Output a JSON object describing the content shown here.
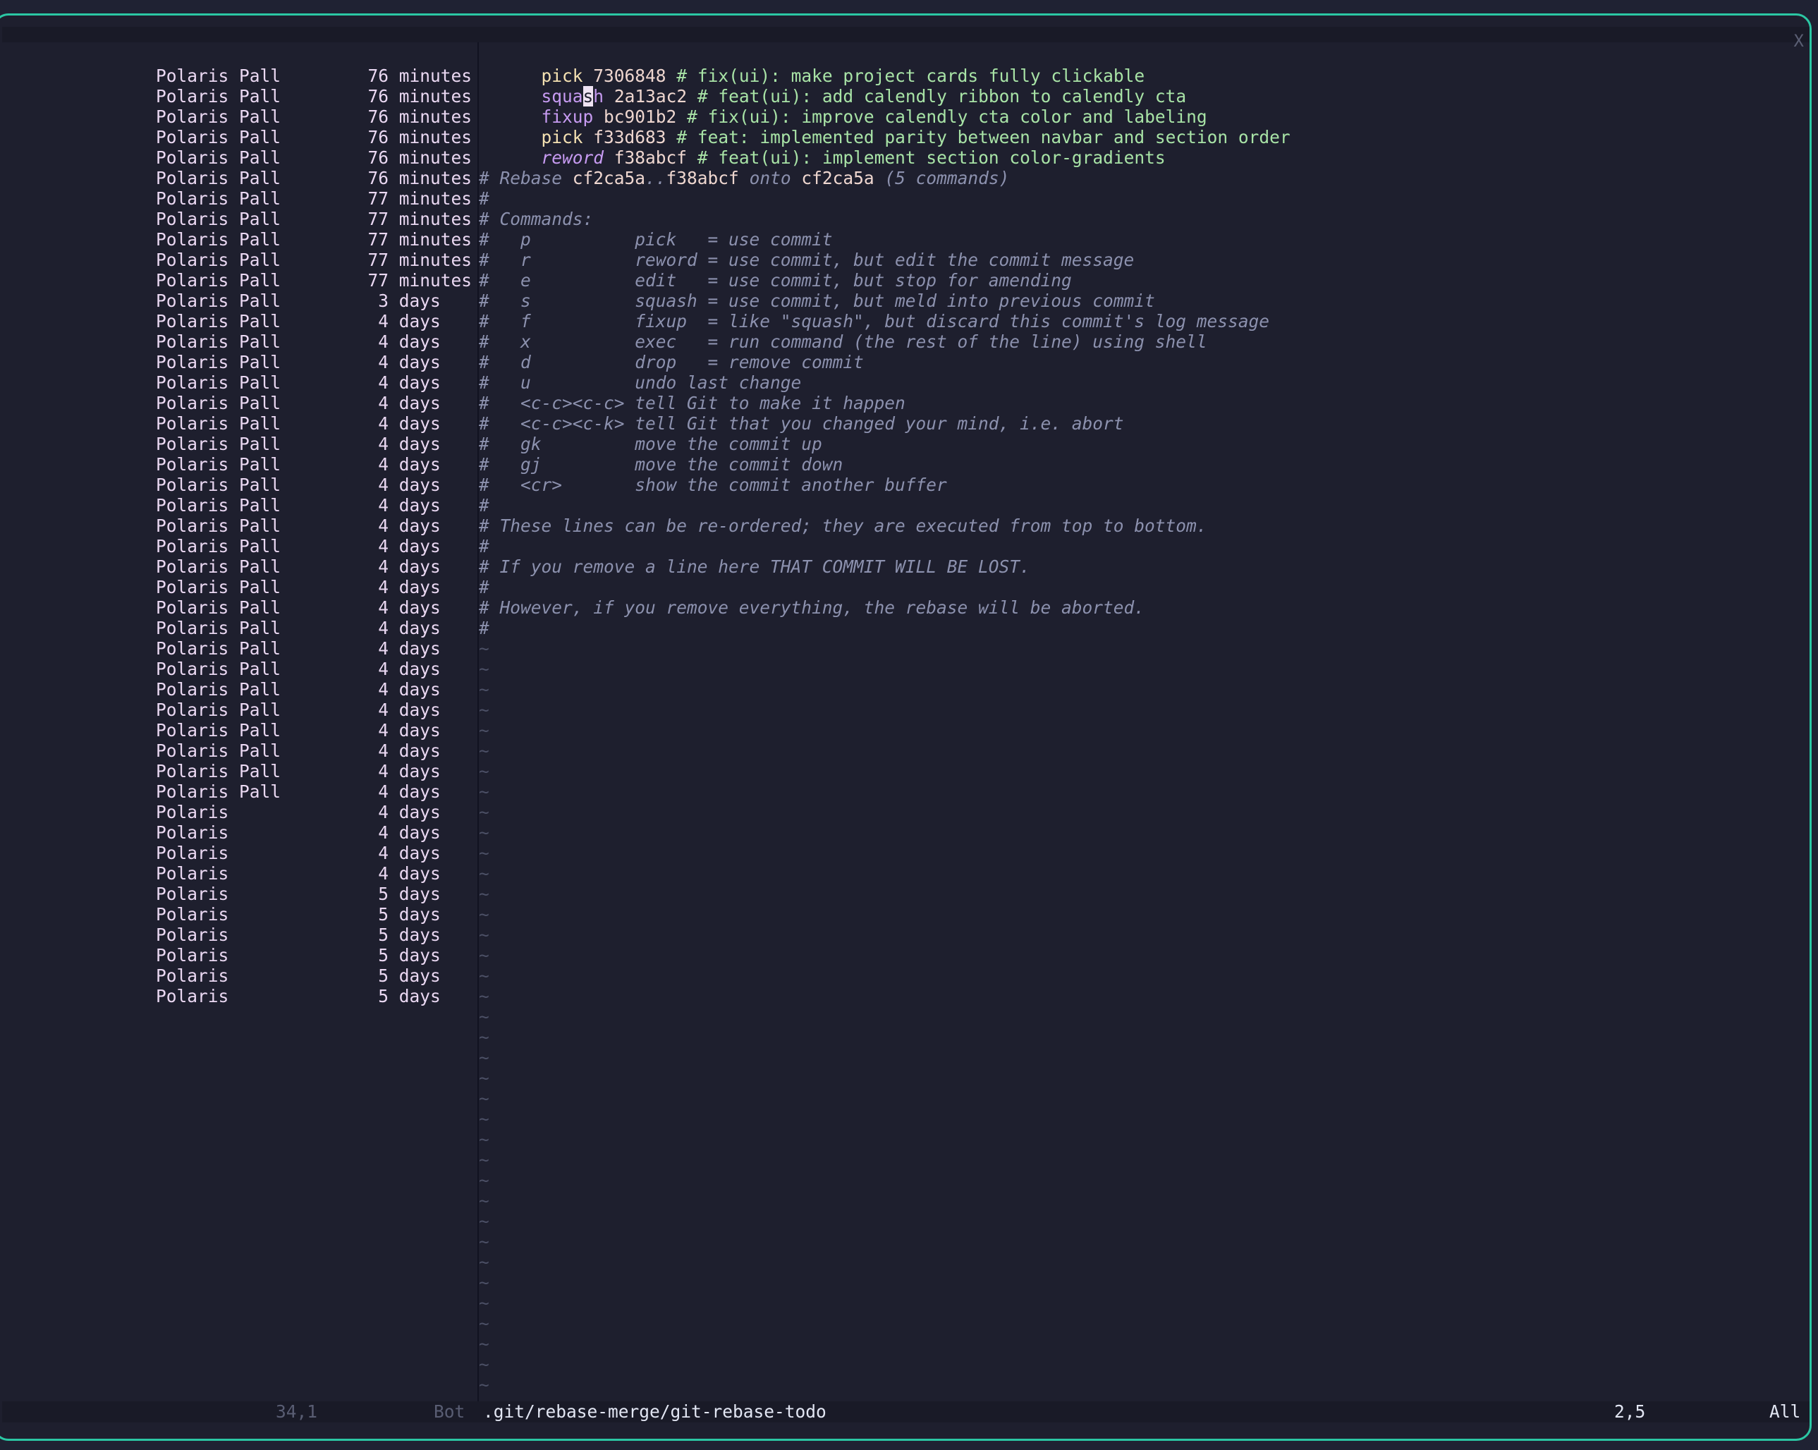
{
  "close_label": "X",
  "blame": [
    {
      "author": "Polaris Pall",
      "age": "76 minutes"
    },
    {
      "author": "Polaris Pall",
      "age": "76 minutes"
    },
    {
      "author": "Polaris Pall",
      "age": "76 minutes"
    },
    {
      "author": "Polaris Pall",
      "age": "76 minutes"
    },
    {
      "author": "Polaris Pall",
      "age": "76 minutes"
    },
    {
      "author": "Polaris Pall",
      "age": "76 minutes"
    },
    {
      "author": "Polaris Pall",
      "age": "77 minutes"
    },
    {
      "author": "Polaris Pall",
      "age": "77 minutes"
    },
    {
      "author": "Polaris Pall",
      "age": "77 minutes"
    },
    {
      "author": "Polaris Pall",
      "age": "77 minutes"
    },
    {
      "author": "Polaris Pall",
      "age": "77 minutes"
    },
    {
      "author": "Polaris Pall",
      "age": "3 days   "
    },
    {
      "author": "Polaris Pall",
      "age": "4 days   "
    },
    {
      "author": "Polaris Pall",
      "age": "4 days   "
    },
    {
      "author": "Polaris Pall",
      "age": "4 days   "
    },
    {
      "author": "Polaris Pall",
      "age": "4 days   "
    },
    {
      "author": "Polaris Pall",
      "age": "4 days   "
    },
    {
      "author": "Polaris Pall",
      "age": "4 days   "
    },
    {
      "author": "Polaris Pall",
      "age": "4 days   "
    },
    {
      "author": "Polaris Pall",
      "age": "4 days   "
    },
    {
      "author": "Polaris Pall",
      "age": "4 days   "
    },
    {
      "author": "Polaris Pall",
      "age": "4 days   "
    },
    {
      "author": "Polaris Pall",
      "age": "4 days   "
    },
    {
      "author": "Polaris Pall",
      "age": "4 days   "
    },
    {
      "author": "Polaris Pall",
      "age": "4 days   "
    },
    {
      "author": "Polaris Pall",
      "age": "4 days   "
    },
    {
      "author": "Polaris Pall",
      "age": "4 days   "
    },
    {
      "author": "Polaris Pall",
      "age": "4 days   "
    },
    {
      "author": "Polaris Pall",
      "age": "4 days   "
    },
    {
      "author": "Polaris Pall",
      "age": "4 days   "
    },
    {
      "author": "Polaris Pall",
      "age": "4 days   "
    },
    {
      "author": "Polaris Pall",
      "age": "4 days   "
    },
    {
      "author": "Polaris Pall",
      "age": "4 days   "
    },
    {
      "author": "Polaris Pall",
      "age": "4 days   "
    },
    {
      "author": "Polaris Pall",
      "age": "4 days   "
    },
    {
      "author": "Polaris Pall",
      "age": "4 days   "
    },
    {
      "author": "Polaris",
      "age": "4 days   "
    },
    {
      "author": "Polaris",
      "age": "4 days   "
    },
    {
      "author": "Polaris",
      "age": "4 days   "
    },
    {
      "author": "Polaris",
      "age": "4 days   "
    },
    {
      "author": "Polaris",
      "age": "5 days   "
    },
    {
      "author": "Polaris",
      "age": "5 days   "
    },
    {
      "author": "Polaris",
      "age": "5 days   "
    },
    {
      "author": "Polaris",
      "age": "5 days   "
    },
    {
      "author": "Polaris",
      "age": "5 days   "
    },
    {
      "author": "Polaris",
      "age": "5 days   "
    }
  ],
  "todo": [
    {
      "cmd": "pick",
      "sha": "7306848",
      "msg": "# fix(ui): make project cards fully clickable"
    },
    {
      "cmd": "squash",
      "sha": "2a13ac2",
      "msg": "# feat(ui): add calendly ribbon to calendly cta"
    },
    {
      "cmd": "fixup",
      "sha": "bc901b2",
      "msg": "# fix(ui): improve calendly cta color and labeling"
    },
    {
      "cmd": "pick",
      "sha": "f33d683",
      "msg": "# feat: implemented parity between navbar and section order"
    },
    {
      "cmd": "reword",
      "sha": "f38abcf",
      "msg": "# feat(ui): implement section color-gradients"
    }
  ],
  "rebase_header": {
    "prefix": "# Rebase ",
    "from": "cf2ca5a",
    "dots": "..",
    "to": "f38abcf",
    "onto_word": " onto ",
    "onto": "cf2ca5a",
    "suffix": " (5 commands)"
  },
  "help_lines": [
    "#",
    "# Commands:",
    "#   p          pick   = use commit",
    "#   r          reword = use commit, but edit the commit message",
    "#   e          edit   = use commit, but stop for amending",
    "#   s          squash = use commit, but meld into previous commit",
    "#   f          fixup  = like \"squash\", but discard this commit's log message",
    "#   x          exec   = run command (the rest of the line) using shell",
    "#   d          drop   = remove commit",
    "#   u          undo last change",
    "#   <c-c><c-c> tell Git to make it happen",
    "#   <c-c><c-k> tell Git that you changed your mind, i.e. abort",
    "#   gk         move the commit up",
    "#   gj         move the commit down",
    "#   <cr>       show the commit another buffer",
    "#",
    "# These lines can be re-ordered; they are executed from top to bottom.",
    "#",
    "# If you remove a line here THAT COMMIT WILL BE LOST.",
    "#",
    "# However, if you remove everything, the rebase will be aborted.",
    "#"
  ],
  "tilde_char": "~",
  "tilde_count": 37,
  "status": {
    "left_pos": "34,1",
    "left_scroll": "Bot",
    "file": ".git/rebase-merge/git-rebase-todo",
    "right_pos": "2,5",
    "right_scroll": "All"
  }
}
